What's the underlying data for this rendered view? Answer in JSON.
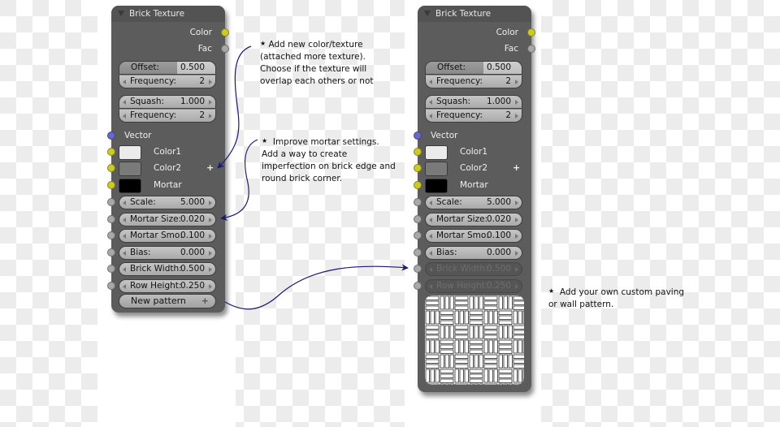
{
  "nodes": [
    {
      "title": "Brick Texture",
      "outputs": [
        {
          "label": "Color",
          "socket": "yellow"
        },
        {
          "label": "Fac",
          "socket": "gray"
        }
      ],
      "offset_group": {
        "offset_label": "Offset:",
        "offset_value": "0.500",
        "freq_label": "Frequency:",
        "freq_value": "2"
      },
      "squash_group": {
        "squash_label": "Squash:",
        "squash_value": "1.000",
        "freq_label": "Frequency:",
        "freq_value": "2"
      },
      "vector_label": "Vector",
      "colors": [
        {
          "label": "Color1",
          "swatch": "#ebebeb"
        },
        {
          "label": "Color2",
          "swatch": "#7a7a7a"
        },
        {
          "label": "Mortar",
          "swatch": "#000000"
        }
      ],
      "add_color_icon": "plus-icon",
      "params": [
        {
          "label": "Scale:",
          "value": "5.000",
          "disabled": false
        },
        {
          "label": "Mortar Size:",
          "value": "0.020",
          "disabled": false
        },
        {
          "label": "Mortar Smo:",
          "value": "0.100",
          "disabled": false
        },
        {
          "label": "Bias:",
          "value": "0.000",
          "disabled": false
        },
        {
          "label": "Brick Width:",
          "value": "0.500",
          "disabled": false
        },
        {
          "label": "Row Height:",
          "value": "0.250",
          "disabled": false
        }
      ],
      "new_pattern_label": "New pattern"
    },
    {
      "title": "Brick Texture",
      "outputs": [
        {
          "label": "Color",
          "socket": "yellow"
        },
        {
          "label": "Fac",
          "socket": "gray"
        }
      ],
      "offset_group": {
        "offset_label": "Offset:",
        "offset_value": "0.500",
        "freq_label": "Frequency:",
        "freq_value": "2"
      },
      "squash_group": {
        "squash_label": "Squash:",
        "squash_value": "1.000",
        "freq_label": "Frequency:",
        "freq_value": "2"
      },
      "vector_label": "Vector",
      "colors": [
        {
          "label": "Color1",
          "swatch": "#ebebeb"
        },
        {
          "label": "Color2",
          "swatch": "#7a7a7a"
        },
        {
          "label": "Mortar",
          "swatch": "#000000"
        }
      ],
      "add_color_icon": "plus-icon",
      "params": [
        {
          "label": "Scale:",
          "value": "5.000",
          "disabled": false
        },
        {
          "label": "Mortar Size:",
          "value": "0.020",
          "disabled": false
        },
        {
          "label": "Mortar Smo:",
          "value": "0.100",
          "disabled": false
        },
        {
          "label": "Bias:",
          "value": "0.000",
          "disabled": false
        },
        {
          "label": "Brick Width:",
          "value": "0.500",
          "disabled": true
        },
        {
          "label": "Row Height:",
          "value": "0.250",
          "disabled": true
        }
      ],
      "preview": "basketweave-pattern"
    }
  ],
  "notes": [
    {
      "bullet": "★",
      "text": " Add new color/texture\n(attached more texture).\nChoose if the texture will\noverlap each others or not"
    },
    {
      "bullet": "★",
      "text": "  Improve mortar settings.\nAdd a way to create\nimperfection on brick edge and\nround brick corner."
    },
    {
      "bullet": "★",
      "text": "  Add your own custom paving\nor wall pattern."
    }
  ],
  "colors": {
    "node_bg": "#5c5c5c",
    "socket_yellow": "#cbcb28",
    "socket_gray": "#a8a8a8",
    "socket_blue": "#6868cc",
    "arrow": "#1a1a6e",
    "checker_light": "#ececec"
  }
}
